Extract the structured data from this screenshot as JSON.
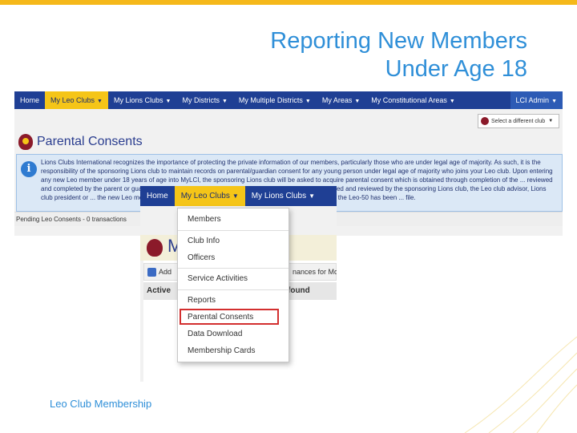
{
  "slide": {
    "title_line1": "Reporting New Members",
    "title_line2": "Under Age 18",
    "footer": "Leo Club Membership"
  },
  "colors": {
    "brand_blue": "#1f3f94",
    "accent_yellow": "#f5c518",
    "title_blue": "#2f8fd8",
    "highlight_red": "#d32f2f"
  },
  "screenshot_main": {
    "nav": [
      "Home",
      "My Leo Clubs",
      "My Lions Clubs",
      "My Districts",
      "My Multiple Districts",
      "My Areas",
      "My Constitutional Areas"
    ],
    "active_nav": "My Leo Clubs",
    "admin_label": "LCI Admin",
    "club_selector": "Select a different club",
    "page_title": "Parental Consents",
    "info_text": "Lions Clubs International recognizes the importance of protecting the private information of our members, particularly those who are under legal age of majority. As such, it is the responsibility of the sponsoring Lions club to maintain records on parental/guardian consent for any young person under legal age of majority who joins your Leo club. Upon entering any new Leo member under 18 years of age into MyLCI, the sponsoring Lions club will be asked to acquire parental consent which is obtained through completion of the ... reviewed and completed by the parent or guardian for all Leo members under legal age of majority. Once ... received and reviewed by the sponsoring Lions club, the Leo club advisor, Lions club president or ... the new Leo member in question. The parental consent should not be approved until the Leo-50 has been ... file.",
    "pending": "Pending Leo Consents - 0 transactions"
  },
  "screenshot_zoom": {
    "nav": [
      "Home",
      "My Leo Clubs",
      "My Lions Clubs"
    ],
    "active_nav": "My Leo Clubs",
    "heading_partial": "M",
    "toolbar_add": "Add",
    "toolbar_finances": "nances for Mo",
    "row_active": "Active",
    "row_found": "found"
  },
  "menu": {
    "items": [
      "Members",
      "Club Info",
      "Officers",
      "Service Activities",
      "Reports",
      "Parental Consents",
      "Data Download",
      "Membership Cards"
    ],
    "highlighted": "Parental Consents"
  },
  "icons": [
    "info-icon",
    "lions-crest-icon",
    "caret-down-icon",
    "add-icon"
  ]
}
